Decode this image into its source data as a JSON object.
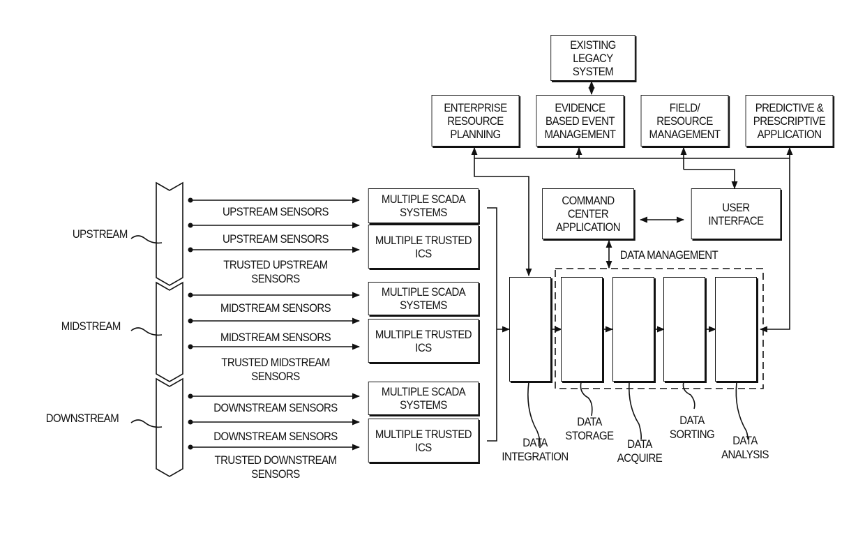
{
  "top": {
    "legacy": "EXISTING LEGACY\nSYSTEM",
    "apps": [
      "ENTERPRISE\nRESOURCE\nPLANNING",
      "EVIDENCE\nBASED EVENT\nMANAGEMENT",
      "FIELD/\nRESOURCE\nMANAGEMENT",
      "PREDICTIVE &\nPRESCRIPTIVE\nAPPLICATION"
    ]
  },
  "center": {
    "command": "COMMAND\nCENTER\nAPPLICATION",
    "ui": "USER\nINTERFACE",
    "data_management": "DATA MANAGEMENT"
  },
  "streams": [
    "UPSTREAM",
    "MIDSTREAM",
    "DOWNSTREAM"
  ],
  "sensors": [
    "UPSTREAM SENSORS",
    "UPSTREAM SENSORS",
    "TRUSTED UPSTREAM\nSENSORS",
    "MIDSTREAM SENSORS",
    "MIDSTREAM SENSORS",
    "TRUSTED MIDSTREAM\nSENSORS",
    "DOWNSTREAM SENSORS",
    "DOWNSTREAM SENSORS",
    "TRUSTED DOWNSTREAM\nSENSORS"
  ],
  "systems": [
    "MULTIPLE SCADA\nSYSTEMS",
    "MULTIPLE TRUSTED\nICS",
    "MULTIPLE SCADA\nSYSTEMS",
    "MULTIPLE TRUSTED\nICS",
    "MULTIPLE SCADA\nSYSTEMS",
    "MULTIPLE TRUSTED\nICS"
  ],
  "pipeline": [
    "DATA\nINTEGRATION",
    "DATA\nSTORAGE",
    "DATA\nACQUIRE",
    "DATA\nSORTING",
    "DATA\nANALYSIS"
  ]
}
